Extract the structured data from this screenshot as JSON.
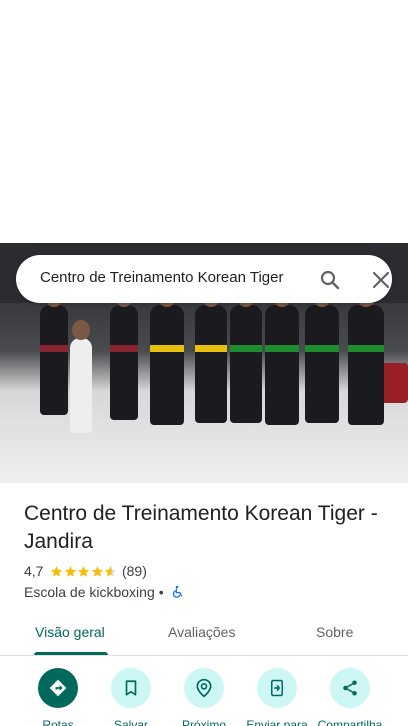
{
  "search": {
    "query": "Centro de Treinamento Korean Tiger"
  },
  "place": {
    "title": "Centro de Treinamento Korean Tiger - Jandira",
    "rating": "4,7",
    "rating_value": 4.7,
    "review_count": "(89)",
    "category": "Escola de kickboxing",
    "separator": "•"
  },
  "tabs": [
    {
      "label": "Visão geral",
      "active": true
    },
    {
      "label": "Avaliações",
      "active": false
    },
    {
      "label": "Sobre",
      "active": false
    }
  ],
  "actions": [
    {
      "label": "Rotas",
      "icon": "directions-icon"
    },
    {
      "label": "Salvar",
      "icon": "bookmark-icon"
    },
    {
      "label": "Próximo",
      "icon": "nearby-icon"
    },
    {
      "label": "Enviar para",
      "icon": "send-to-phone-icon"
    },
    {
      "label": "Compartilha",
      "icon": "share-icon"
    }
  ],
  "colors": {
    "accent": "#00695c",
    "action_bg": "#cdf7f4",
    "star": "#fbbc04",
    "accessible": "#1a73e8"
  }
}
